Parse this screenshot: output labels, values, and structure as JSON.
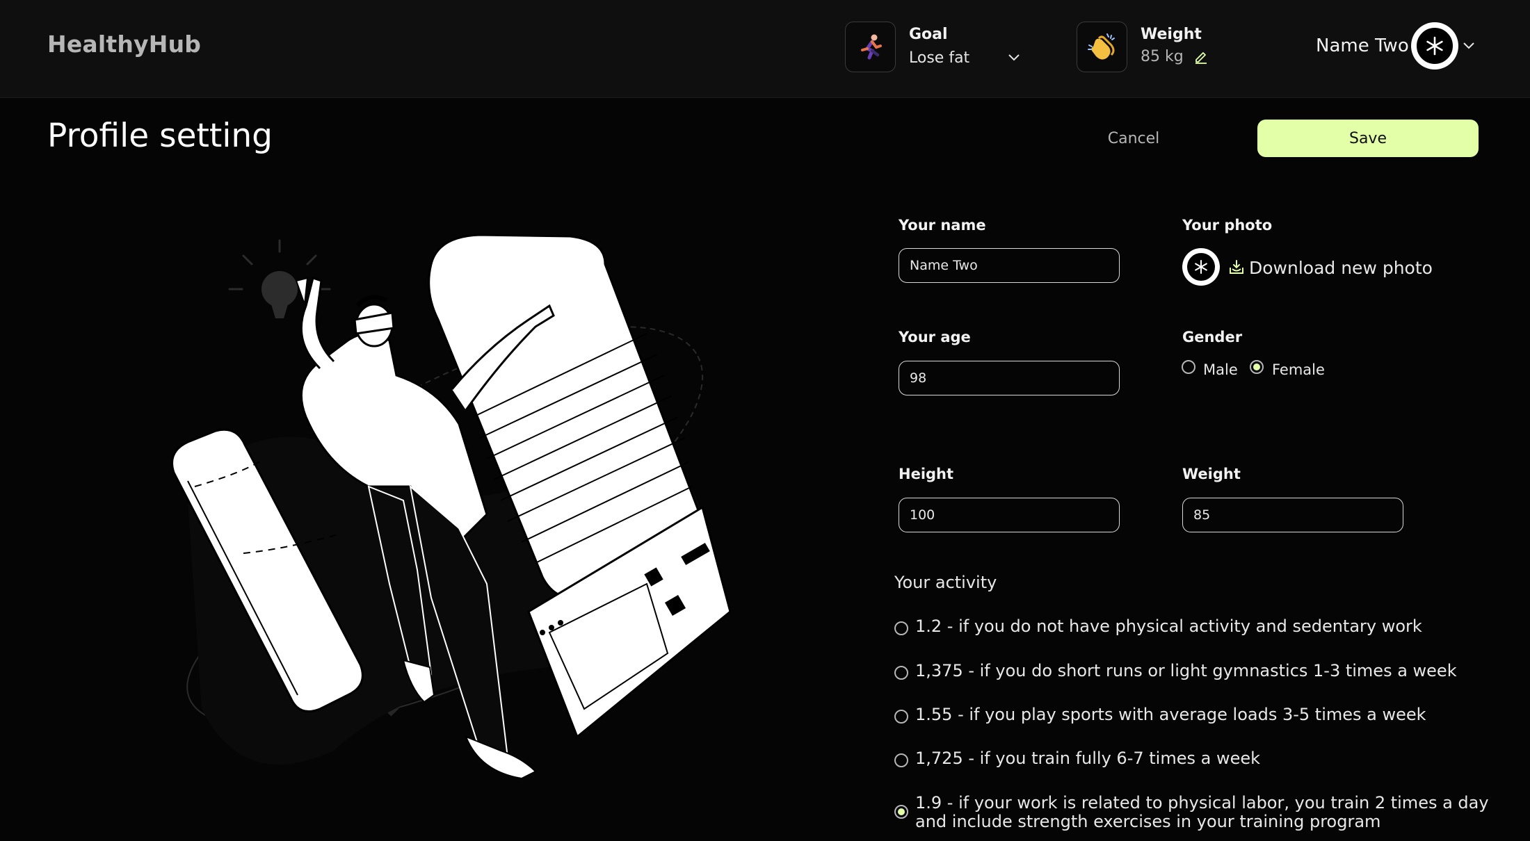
{
  "header": {
    "logo": "HealthyHub",
    "goal": {
      "title": "Goal",
      "value": "Lose fat",
      "icon": "running-person-icon"
    },
    "weight": {
      "title": "Weight",
      "value": "85 kg",
      "icon": "clapping-hands-icon"
    },
    "user": {
      "name": "Name Two",
      "avatar_icon": "snowflake-icon"
    }
  },
  "page": {
    "title": "Profile setting",
    "cancel_label": "Cancel",
    "save_label": "Save"
  },
  "form": {
    "name": {
      "label": "Your name",
      "value": "Name Two"
    },
    "photo": {
      "label": "Your photo",
      "download_label": "Download new photo"
    },
    "age": {
      "label": "Your age",
      "value": "98"
    },
    "gender": {
      "label": "Gender",
      "options": [
        "Male",
        "Female"
      ],
      "selected": "Female"
    },
    "height": {
      "label": "Height",
      "value": "100"
    },
    "weight": {
      "label": "Weight",
      "value": "85"
    },
    "activity": {
      "label": "Your activity",
      "options": [
        "1.2 - if you do not have physical activity and sedentary work",
        "1,375 - if you do short runs or light gymnastics 1-3 times a week",
        "1.55 - if you play sports with average loads 3-5 times a week",
        "1,725 - if you train fully 6-7 times a week",
        "1.9 - if your work is related to physical labor, you train 2 times a day and include strength exercises in your training program"
      ],
      "selected_index": 4
    }
  },
  "colors": {
    "accent": "#e3ffa8",
    "background": "#050505",
    "header_bg": "#0f0f0f",
    "muted_text": "#b6b6b6"
  }
}
